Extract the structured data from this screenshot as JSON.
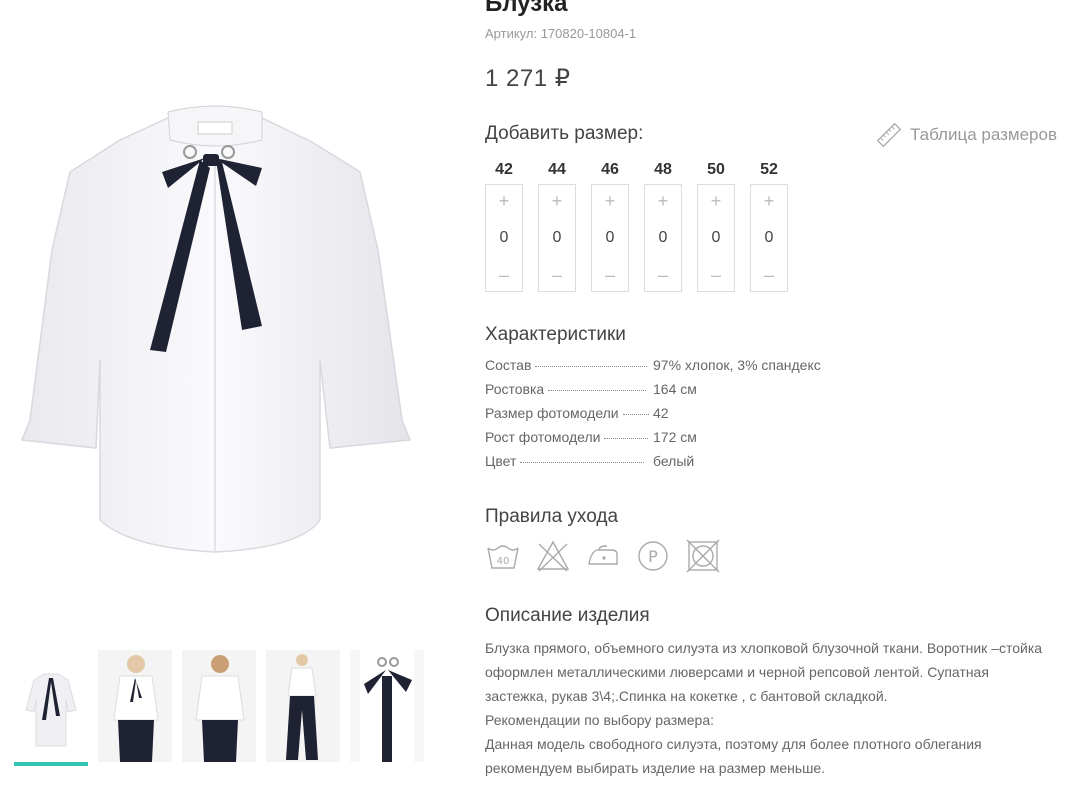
{
  "product": {
    "title": "Блузка",
    "sku_text": "Артикул: 170820-10804-1",
    "price": "1 271 ₽"
  },
  "sizes_section": {
    "heading": "Добавить размер:",
    "size_table_link": "Таблица размеров",
    "sizes": [
      {
        "label": "42",
        "qty": "0"
      },
      {
        "label": "44",
        "qty": "0"
      },
      {
        "label": "46",
        "qty": "0"
      },
      {
        "label": "48",
        "qty": "0"
      },
      {
        "label": "50",
        "qty": "0"
      },
      {
        "label": "52",
        "qty": "0"
      }
    ],
    "plus": "+",
    "minus": "–"
  },
  "characteristics": {
    "heading": "Характеристики",
    "rows": [
      {
        "key": "Состав",
        "value": "97% хлопок, 3% спандекс"
      },
      {
        "key": "Ростовка",
        "value": "164 см"
      },
      {
        "key": "Размер фотомодели",
        "value": "42"
      },
      {
        "key": "Рост фотомодели",
        "value": "172 см"
      },
      {
        "key": "Цвет",
        "value": "белый"
      }
    ]
  },
  "care": {
    "heading": "Правила ухода",
    "icons": [
      "wash-40-icon",
      "no-bleach-icon",
      "iron-low-icon",
      "dry-clean-p-icon",
      "no-tumble-dry-icon"
    ],
    "wash_temp": "40",
    "dry_clean_letter": "P"
  },
  "description": {
    "heading": "Описание изделия",
    "lines": [
      "Блузка прямого, объемного силуэта из хлопковой блузочной ткани. Воротник –стойка",
      "оформлен металлическими люверсами и черной репсовой лентой. Супатная",
      "застежка, рукав 3\\4;.Спинка на кокетке , с бантовой складкой.",
      "Рекомендации по выбору размера:",
      "Данная модель свободного силуэта, поэтому для более плотного облегания",
      "рекомендуем выбирать изделие на размер меньше."
    ]
  },
  "gallery": {
    "thumbnail_count": 5,
    "active_index": 0
  },
  "colors": {
    "accent": "#33c7b3",
    "muted_text": "#999999",
    "border": "#dddddd"
  }
}
